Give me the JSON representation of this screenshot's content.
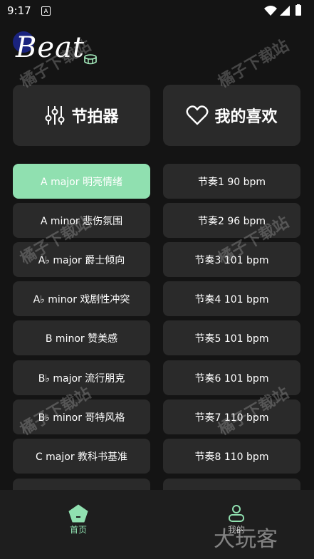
{
  "status_bar": {
    "time": "9:17",
    "notification_letter": "A"
  },
  "logo": {
    "text": "Beat"
  },
  "big_cards": [
    {
      "label": "节拍器",
      "icon": "sliders-icon"
    },
    {
      "label": "我的喜欢",
      "icon": "heart-icon"
    }
  ],
  "keys": [
    "A major 明亮情绪",
    "A minor 悲伤氛围",
    "A♭ major 爵士倾向",
    "A♭ minor 戏剧性冲突",
    "B minor 赞美感",
    "B♭ major 流行朋克",
    "B♭ minor 哥特风格",
    "C major 教科书基准"
  ],
  "rhythms": [
    "节奏1 90 bpm",
    "节奏2 96 bpm",
    "节奏3 101 bpm",
    "节奏4 101 bpm",
    "节奏5 101 bpm",
    "节奏6 101 bpm",
    "节奏7 110 bpm",
    "节奏8 110 bpm"
  ],
  "bottom_nav": [
    {
      "label": "首页",
      "icon": "home-pentagon-icon",
      "active": true
    },
    {
      "label": "我的",
      "icon": "profile-icon",
      "active": false
    }
  ],
  "watermark": "橘子下载站",
  "corner_mark": "大玩客",
  "colors": {
    "background": "#141414",
    "card": "#2a2a2a",
    "accent": "#90e0b0",
    "nav": "#1e1e1e"
  }
}
